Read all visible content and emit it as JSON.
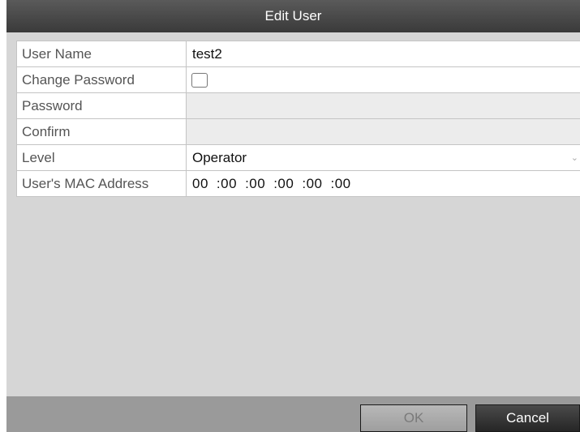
{
  "dialog": {
    "title": "Edit User"
  },
  "form": {
    "user_name": {
      "label": "User Name",
      "value": "test2"
    },
    "change_password": {
      "label": "Change Password",
      "checked": false
    },
    "password": {
      "label": "Password",
      "value": ""
    },
    "confirm": {
      "label": "Confirm",
      "value": ""
    },
    "level": {
      "label": "Level",
      "value": "Operator"
    },
    "mac_address": {
      "label": "User's MAC Address",
      "segments": [
        "00",
        ":00",
        ":00",
        ":00",
        ":00",
        ":00"
      ]
    }
  },
  "buttons": {
    "ok": "OK",
    "cancel": "Cancel"
  },
  "colors": {
    "title_bar": "#3a3a3a",
    "panel_bg": "#d6d6d6",
    "footer_bg": "#9a9a9a",
    "cancel_bg": "#262626"
  },
  "icons": {
    "dropdown": "chevron-down-icon",
    "checkbox": "checkbox-icon"
  }
}
